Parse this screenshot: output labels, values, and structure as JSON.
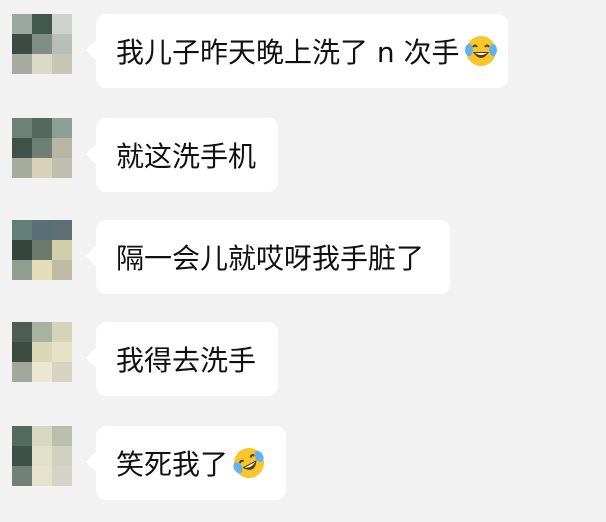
{
  "messages": [
    {
      "text": "我儿子昨天晚上洗了 n 次手",
      "emoji": "tears-of-joy-emoji"
    },
    {
      "text": "就这洗手机",
      "emoji": ""
    },
    {
      "text": "隔一会儿就哎呀我手脏了",
      "emoji": ""
    },
    {
      "text": "我得去洗手",
      "emoji": ""
    },
    {
      "text": "笑死我了",
      "emoji": "rolling-laughing-emoji"
    }
  ],
  "colors": {
    "background": "#f2f2f2",
    "bubble": "#ffffff",
    "text": "#111111",
    "emoji": "#f7c52c"
  }
}
